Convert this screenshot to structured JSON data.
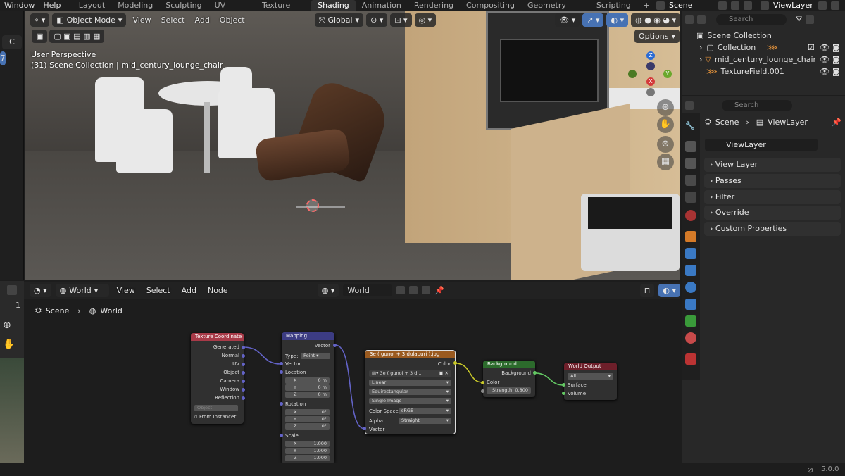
{
  "topbar": {
    "menus": [
      "Window",
      "Help"
    ],
    "workspaces": [
      "Layout",
      "Modeling",
      "Sculpting",
      "UV Editing",
      "Texture Paint",
      "Shading",
      "Animation",
      "Rendering",
      "Compositing",
      "Geometry Nodes",
      "Scripting"
    ],
    "active_workspace": "Shading",
    "add_tab": "+",
    "scene": "Scene",
    "view_layer": "ViewLayer"
  },
  "leftcol": {
    "btn1": "C",
    "btn2": "7"
  },
  "viewport": {
    "mode": "Object Mode",
    "menus": [
      "View",
      "Select",
      "Add",
      "Object"
    ],
    "transform": "Global",
    "options": "Options",
    "info_line1": "User Perspective",
    "info_line2": "(31) Scene Collection | mid_century_lounge_chair"
  },
  "gizmo": {
    "z": "Z",
    "y": "Y",
    "x": "X"
  },
  "outliner": {
    "search_placeholder": "Search",
    "root": "Scene Collection",
    "items": [
      "Collection",
      "mid_century_lounge_chair",
      "TextureField.001"
    ]
  },
  "properties": {
    "search_placeholder": "Search",
    "breadcrumb_scene": "Scene",
    "breadcrumb_layer": "ViewLayer",
    "layer_field": "ViewLayer",
    "panels": [
      "View Layer",
      "Passes",
      "Filter",
      "Override",
      "Custom Properties"
    ]
  },
  "node_editor": {
    "type": "World",
    "menus": [
      "View",
      "Select",
      "Add",
      "Node"
    ],
    "world_field": "World",
    "breadcrumb_scene": "Scene",
    "breadcrumb_world": "World",
    "left_num": "1"
  },
  "nodes": {
    "texcoord": {
      "title": "Texture Coordinate",
      "outputs": [
        "Generated",
        "Normal",
        "UV",
        "Object",
        "Camera",
        "Window",
        "Reflection"
      ],
      "object_placeholder": "Object",
      "from_instancer": "From Instancer"
    },
    "mapping": {
      "title": "Mapping",
      "out": "Vector",
      "type_label": "Type:",
      "type_value": "Point",
      "vector": "Vector",
      "location": "Location",
      "loc": [
        [
          "X",
          "0 m"
        ],
        [
          "Y",
          "0 m"
        ],
        [
          "Z",
          "0 m"
        ]
      ],
      "rotation": "Rotation",
      "rot": [
        [
          "X",
          "0°"
        ],
        [
          "Y",
          "0°"
        ],
        [
          "Z",
          "0°"
        ]
      ],
      "scale": "Scale",
      "scl": [
        [
          "X",
          "1.000"
        ],
        [
          "Y",
          "1.000"
        ],
        [
          "Z",
          "1.000"
        ]
      ]
    },
    "image": {
      "title": "3e ( gunoi + 3 dulapuri ).jpg",
      "color_out": "Color",
      "image_field": "3e ( gunoi + 3 d...",
      "interp": "Linear",
      "proj": "Equirectangular",
      "source": "Single Image",
      "colorspace_label": "Color Space",
      "colorspace": "sRGB",
      "alpha_label": "Alpha",
      "alpha": "Straight",
      "vector_in": "Vector"
    },
    "background": {
      "title": "Background",
      "out": "Background",
      "color_in": "Color",
      "strength_label": "Strength",
      "strength": "0.800"
    },
    "output": {
      "title": "World Output",
      "target": "All",
      "surface": "Surface",
      "volume": "Volume"
    }
  },
  "status": {
    "version": "5.0.0"
  },
  "colors": {
    "accent": "#4772b3",
    "node_input": "#a83a48",
    "node_vector": "#3c3c83",
    "node_texture": "#9a5a1f",
    "node_shader": "#2c6b2c",
    "node_output": "#6e1f2a"
  }
}
